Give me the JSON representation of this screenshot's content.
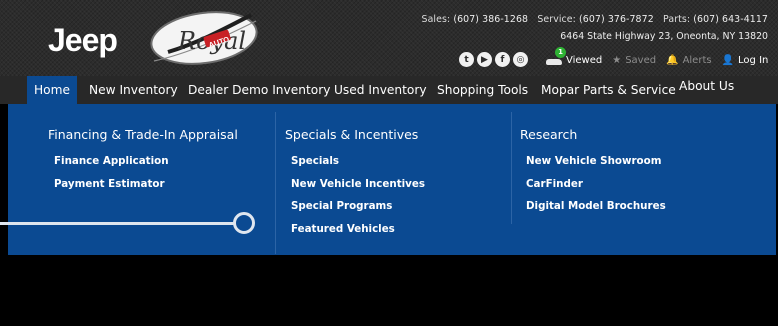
{
  "header": {
    "brand_logo": "Jeep",
    "dealer_logo_script": "Royal",
    "dealer_logo_sub": "AUTO",
    "contact": {
      "sales_label": "Sales:",
      "sales_phone": "(607) 386-1268",
      "service_label": "Service:",
      "service_phone": "(607) 376-7872",
      "parts_label": "Parts:",
      "parts_phone": "(607) 643-4117",
      "address": "6464 State Highway 23, Oneonta, NY 13820"
    },
    "social": [
      {
        "name": "twitter-icon",
        "glyph": "t"
      },
      {
        "name": "youtube-icon",
        "glyph": "▶"
      },
      {
        "name": "facebook-icon",
        "glyph": "f"
      },
      {
        "name": "instagram-icon",
        "glyph": "◎"
      }
    ],
    "utility": {
      "viewed_count": "1",
      "viewed_label": "Viewed",
      "saved_label": "Saved",
      "alerts_label": "Alerts",
      "login_label": "Log In"
    }
  },
  "nav": {
    "items": [
      {
        "label": "Home",
        "active": true
      },
      {
        "label": "New Inventory"
      },
      {
        "label": "Dealer Demo Inventory"
      },
      {
        "label": "Used Inventory"
      },
      {
        "label": "Shopping Tools"
      },
      {
        "label": "Mopar Parts & Service"
      },
      {
        "label": "About Us"
      }
    ]
  },
  "mega_menu": {
    "columns": [
      {
        "heading": "Financing & Trade-In Appraisal",
        "links": [
          "Finance Application",
          "Payment Estimator"
        ]
      },
      {
        "heading": "Specials & Incentives",
        "links": [
          "Specials",
          "New Vehicle Incentives",
          "Special Programs",
          "Featured Vehicles"
        ]
      },
      {
        "heading": "Research",
        "links": [
          "New Vehicle Showroom",
          "CarFinder",
          "Digital Model Brochures"
        ]
      }
    ]
  },
  "colors": {
    "menu_blue": "#0b4a92",
    "nav_dark": "#282828",
    "badge_green": "#2fb234"
  }
}
